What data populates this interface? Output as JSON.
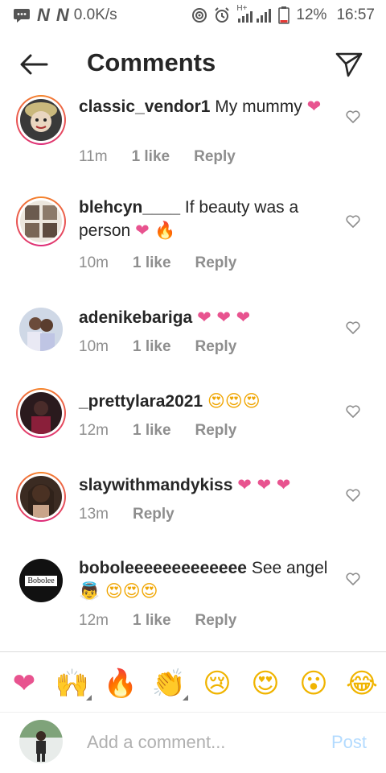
{
  "status_bar": {
    "net_speed": "0.0K/s",
    "network_type": "H+",
    "battery": "12%",
    "time": "16:57"
  },
  "header": {
    "title": "Comments"
  },
  "comments": [
    {
      "username": "classic_vendor1",
      "text": "My mummy",
      "emojis": "❤",
      "time": "11m",
      "likes": "1 like",
      "reply": "Reply"
    },
    {
      "username": "blehcyn____",
      "text": "If beauty was a person",
      "emojis": "❤ 🔥",
      "time": "10m",
      "likes": "1 like",
      "reply": "Reply"
    },
    {
      "username": "adenikebariga",
      "text": "",
      "emojis": "❤ ❤ ❤",
      "time": "10m",
      "likes": "1 like",
      "reply": "Reply"
    },
    {
      "username": "_prettylara2021",
      "text": "",
      "emojis": "😍😍😍",
      "time": "12m",
      "likes": "1 like",
      "reply": "Reply"
    },
    {
      "username": "slaywithmandykiss",
      "text": "",
      "emojis": "❤ ❤ ❤",
      "time": "13m",
      "likes": "",
      "reply": "Reply"
    },
    {
      "username": "boboleeeeeeeeeeeee",
      "text": "See angel",
      "emojis": "👼 😍😍😍",
      "time": "12m",
      "likes": "1 like",
      "reply": "Reply",
      "avatar_text": "Bobolee"
    }
  ],
  "reactions": [
    "❤",
    "🙌",
    "🔥",
    "👏",
    "😢",
    "😍",
    "😮",
    "😂"
  ],
  "input": {
    "placeholder": "Add a comment...",
    "post_label": "Post"
  },
  "colors": {
    "heart": "#e8538f",
    "muted": "#8e8e8e",
    "post_disabled": "#b3dbff"
  }
}
